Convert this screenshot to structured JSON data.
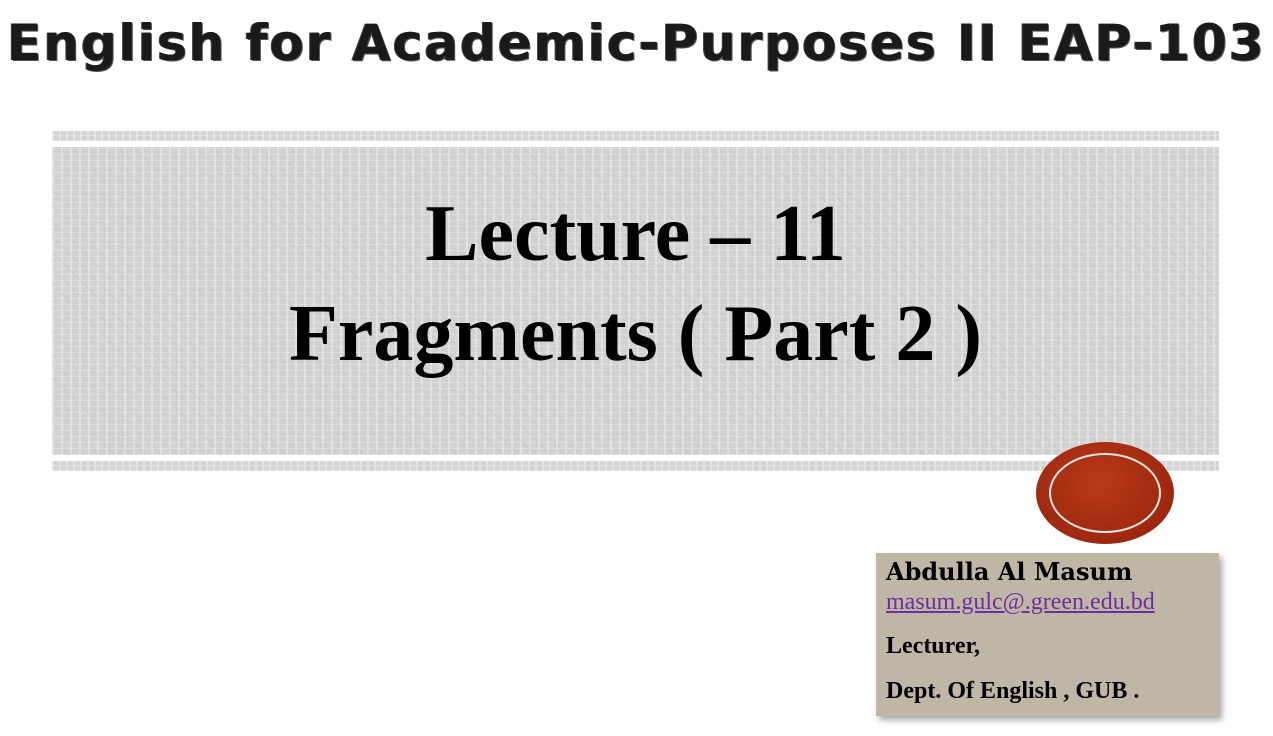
{
  "slide": {
    "header": "English for Academic-Purposes II EAP-103",
    "title_line1": "Lecture – 11",
    "title_line2": "Fragments ( Part 2 )"
  },
  "presenter": {
    "name": "Abdulla Al Masum",
    "email": "masum.gulc@.green.edu.bd",
    "role": "Lecturer,",
    "department": "Dept. Of English , GUB ."
  },
  "colors": {
    "seal": "#a22a10",
    "info_box": "#c0b6a6",
    "email_link": "#6b2fa0",
    "panel": "#d2d2d2"
  }
}
